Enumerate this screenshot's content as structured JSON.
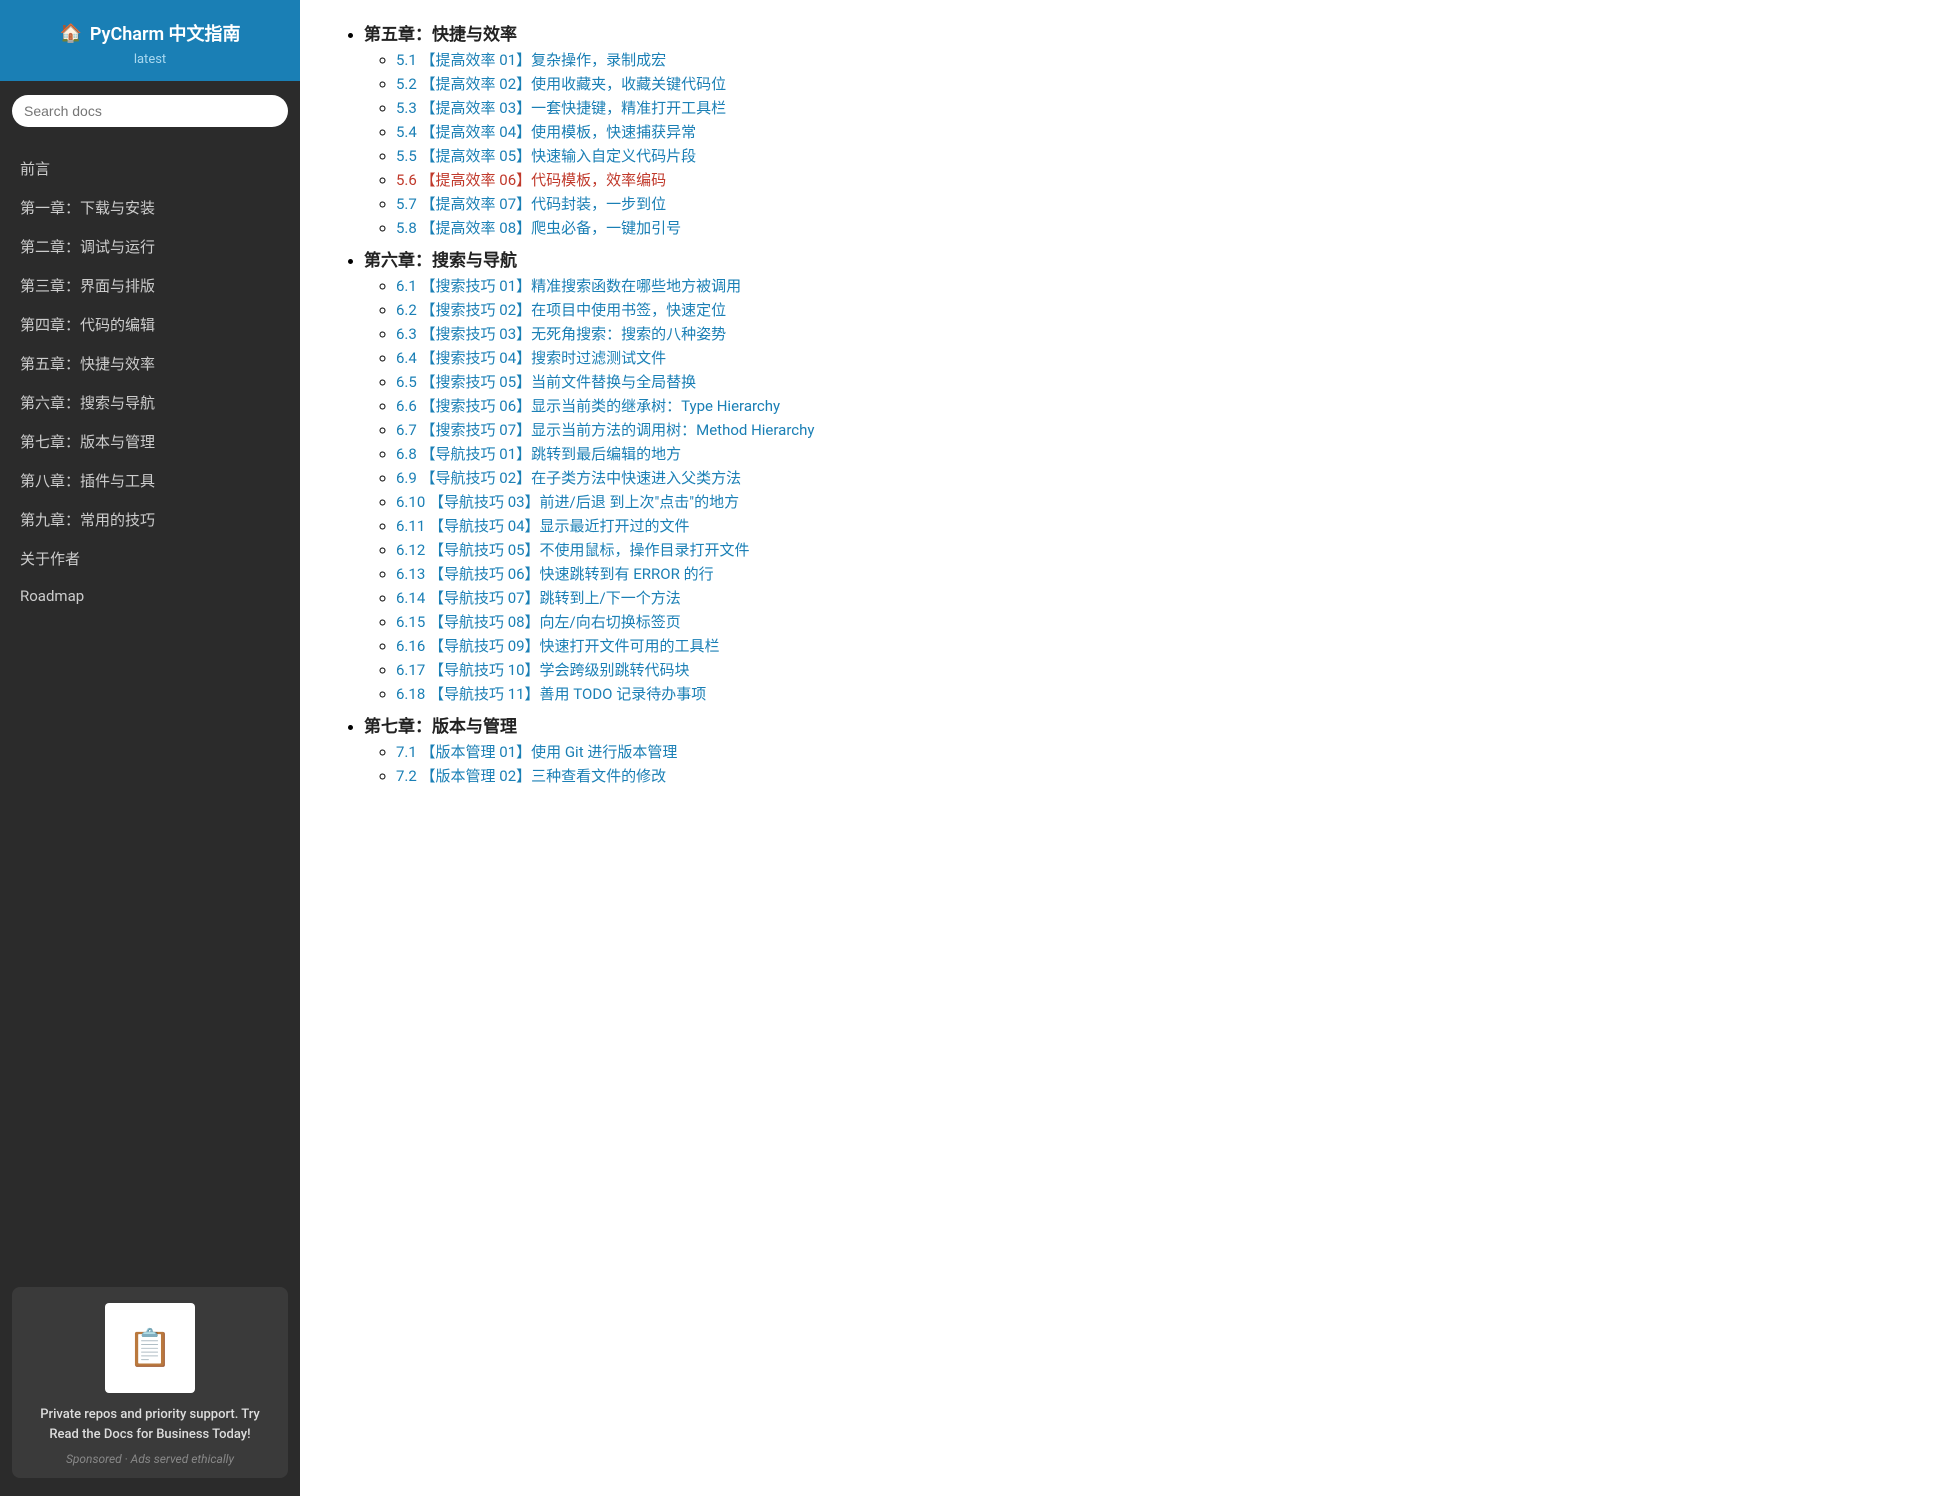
{
  "sidebar": {
    "title": "PyCharm 中文指南",
    "version": "latest",
    "search_placeholder": "Search docs",
    "nav_items": [
      {
        "label": "前言",
        "href": "#"
      },
      {
        "label": "第一章：下载与安装",
        "href": "#"
      },
      {
        "label": "第二章：调试与运行",
        "href": "#"
      },
      {
        "label": "第三章：界面与排版",
        "href": "#"
      },
      {
        "label": "第四章：代码的编辑",
        "href": "#"
      },
      {
        "label": "第五章：快捷与效率",
        "href": "#"
      },
      {
        "label": "第六章：搜索与导航",
        "href": "#"
      },
      {
        "label": "第七章：版本与管理",
        "href": "#"
      },
      {
        "label": "第八章：插件与工具",
        "href": "#"
      },
      {
        "label": "第九章：常用的技巧",
        "href": "#"
      },
      {
        "label": "关于作者",
        "href": "#"
      },
      {
        "label": "Roadmap",
        "href": "#"
      }
    ],
    "ad": {
      "text": "Private repos and priority support. Try Read the Docs for Business Today!",
      "sponsored": "Sponsored · Ads served ethically"
    }
  },
  "toc": [
    {
      "label": "第五章：快捷与效率",
      "items": [
        {
          "id": "5.1",
          "label": "【提高效率 01】复杂操作，录制成宏",
          "href": "#",
          "style": "normal"
        },
        {
          "id": "5.2",
          "label": "【提高效率 02】使用收藏夹，收藏关键代码位",
          "href": "#",
          "style": "normal"
        },
        {
          "id": "5.3",
          "label": "【提高效率 03】一套快捷键，精准打开工具栏",
          "href": "#",
          "style": "normal"
        },
        {
          "id": "5.4",
          "label": "【提高效率 04】使用模板，快速捕获异常",
          "href": "#",
          "style": "normal"
        },
        {
          "id": "5.5",
          "label": "【提高效率 05】快速输入自定义代码片段",
          "href": "#",
          "style": "normal"
        },
        {
          "id": "5.6",
          "label": "【提高效率 06】代码模板，效率编码",
          "href": "#",
          "style": "active"
        },
        {
          "id": "5.7",
          "label": "【提高效率 07】代码封装，一步到位",
          "href": "#",
          "style": "normal"
        },
        {
          "id": "5.8",
          "label": "【提高效率 08】爬虫必备，一键加引号",
          "href": "#",
          "style": "normal"
        }
      ]
    },
    {
      "label": "第六章：搜索与导航",
      "items": [
        {
          "id": "6.1",
          "label": "【搜索技巧 01】精准搜索函数在哪些地方被调用",
          "href": "#",
          "style": "normal"
        },
        {
          "id": "6.2",
          "label": "【搜索技巧 02】在项目中使用书签，快速定位",
          "href": "#",
          "style": "normal"
        },
        {
          "id": "6.3",
          "label": "【搜索技巧 03】无死角搜索：搜索的八种姿势",
          "href": "#",
          "style": "normal"
        },
        {
          "id": "6.4",
          "label": "【搜索技巧 04】搜索时过滤测试文件",
          "href": "#",
          "style": "normal"
        },
        {
          "id": "6.5",
          "label": "【搜索技巧 05】当前文件替换与全局替换",
          "href": "#",
          "style": "normal"
        },
        {
          "id": "6.6",
          "label": "【搜索技巧 06】显示当前类的继承树：Type Hierarchy",
          "href": "#",
          "style": "normal"
        },
        {
          "id": "6.7",
          "label": "【搜索技巧 07】显示当前方法的调用树：Method Hierarchy",
          "href": "#",
          "style": "normal"
        },
        {
          "id": "6.8",
          "label": "【导航技巧 01】跳转到最后编辑的地方",
          "href": "#",
          "style": "normal"
        },
        {
          "id": "6.9",
          "label": "【导航技巧 02】在子类方法中快速进入父类方法",
          "href": "#",
          "style": "normal"
        },
        {
          "id": "6.10",
          "label": "【导航技巧 03】前进/后退 到上次\"点击\"的地方",
          "href": "#",
          "style": "normal"
        },
        {
          "id": "6.11",
          "label": "【导航技巧 04】显示最近打开过的文件",
          "href": "#",
          "style": "normal"
        },
        {
          "id": "6.12",
          "label": "【导航技巧 05】不使用鼠标，操作目录打开文件",
          "href": "#",
          "style": "normal"
        },
        {
          "id": "6.13",
          "label": "【导航技巧 06】快速跳转到有 ERROR 的行",
          "href": "#",
          "style": "normal"
        },
        {
          "id": "6.14",
          "label": "【导航技巧 07】跳转到上/下一个方法",
          "href": "#",
          "style": "normal"
        },
        {
          "id": "6.15",
          "label": "【导航技巧 08】向左/向右切换标签页",
          "href": "#",
          "style": "normal"
        },
        {
          "id": "6.16",
          "label": "【导航技巧 09】快速打开文件可用的工具栏",
          "href": "#",
          "style": "normal"
        },
        {
          "id": "6.17",
          "label": "【导航技巧 10】学会跨级别跳转代码块",
          "href": "#",
          "style": "normal"
        },
        {
          "id": "6.18",
          "label": "【导航技巧 11】善用 TODO 记录待办事项",
          "href": "#",
          "style": "normal"
        }
      ]
    },
    {
      "label": "第七章：版本与管理",
      "items": [
        {
          "id": "7.1",
          "label": "【版本管理 01】使用 Git 进行版本管理",
          "href": "#",
          "style": "normal"
        },
        {
          "id": "7.2",
          "label": "【版本管理 02】三种查看文件的修改",
          "href": "#",
          "style": "normal"
        }
      ]
    }
  ]
}
